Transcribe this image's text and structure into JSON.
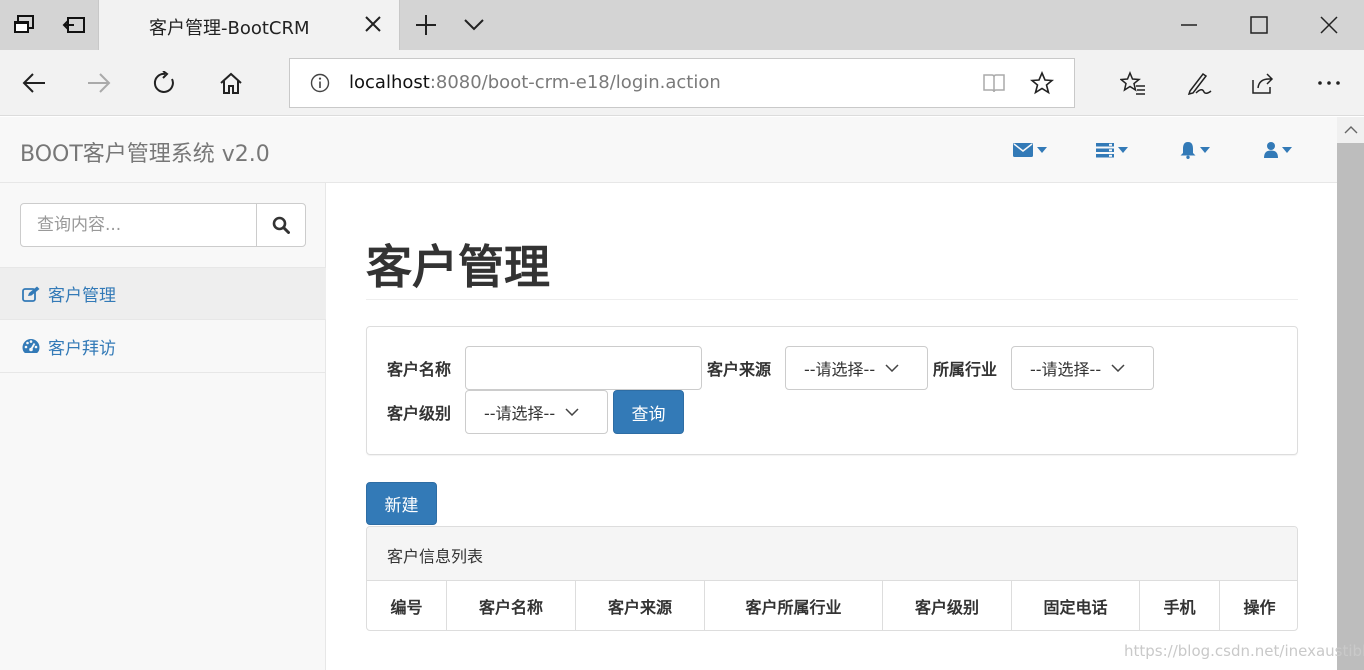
{
  "browser": {
    "tab_title": "客户管理-BootCRM",
    "url_host": "localhost",
    "url_rest": ":8080/boot-crm-e18/login.action",
    "icons": [
      "tab-list-icon",
      "set-aside-icon",
      "new-tab-icon",
      "tab-dropdown-icon",
      "back-icon",
      "forward-icon",
      "refresh-icon",
      "home-icon",
      "site-info-icon",
      "reading-view-icon",
      "favorite-star-icon",
      "favorites-hub-icon",
      "pen-icon",
      "share-icon",
      "more-icon",
      "minimize-icon",
      "maximize-icon",
      "close-icon"
    ]
  },
  "app": {
    "brand": "BOOT客户管理系统 v2.0",
    "header_icons": [
      "envelope-icon",
      "tasks-icon",
      "bell-icon",
      "user-icon"
    ],
    "accent": "#337ab7"
  },
  "sidebar": {
    "search_placeholder": "查询内容...",
    "items": [
      {
        "label": "客户管理",
        "icon": "edit-icon",
        "active": true
      },
      {
        "label": "客户拜访",
        "icon": "dashboard-icon",
        "active": false
      }
    ]
  },
  "main": {
    "title": "客户管理",
    "filters": {
      "name_label": "客户名称",
      "name_value": "",
      "source_label": "客户来源",
      "source_value": "--请选择--",
      "industry_label": "所属行业",
      "industry_value": "--请选择--",
      "level_label": "客户级别",
      "level_value": "--请选择--",
      "search_button": "查询"
    },
    "new_button": "新建",
    "list": {
      "heading": "客户信息列表",
      "columns": [
        "编号",
        "客户名称",
        "客户来源",
        "客户所属行业",
        "客户级别",
        "固定电话",
        "手机",
        "操作"
      ]
    }
  },
  "watermark": "https://blog.csdn.net/inexaustible"
}
